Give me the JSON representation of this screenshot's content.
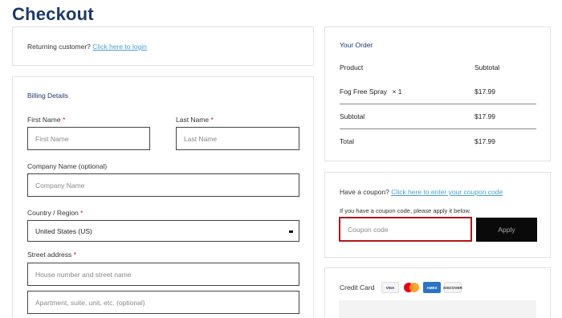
{
  "page": {
    "title": "Checkout"
  },
  "login": {
    "prompt": "Returning customer?",
    "link": "Click here to login"
  },
  "billing": {
    "heading": "Billing Details",
    "first_name": {
      "label": "First Name",
      "required": "*",
      "placeholder": "First Name"
    },
    "last_name": {
      "label": "Last Name",
      "required": "*",
      "placeholder": "Last Name"
    },
    "company": {
      "label": "Company Name (optional)",
      "placeholder": "Company Name"
    },
    "country": {
      "label": "Country / Region",
      "required": "*",
      "value": "United States (US)"
    },
    "street": {
      "label": "Street address",
      "required": "*",
      "placeholder": "House number and street name",
      "placeholder2": "Apartment, suite, unit, etc. (optional)"
    }
  },
  "order": {
    "heading": "Your Order",
    "col_product": "Product",
    "col_subtotal": "Subtotal",
    "items": [
      {
        "name": "Fog Free Spray",
        "qty": "× 1",
        "price": "$17.99"
      }
    ],
    "subtotal_label": "Subtotal",
    "subtotal_value": "$17.99",
    "total_label": "Total",
    "total_value": "$17.99"
  },
  "coupon": {
    "prompt": "Have a coupon?",
    "link": "Click here to enter your coupon code",
    "hint": "If you have a coupon code, please apply it below.",
    "placeholder": "Coupon code",
    "apply_label": "Apply",
    "highlight_color": "#b3161b"
  },
  "payment": {
    "method": "Credit Card",
    "cards": [
      "VISA",
      "mastercard",
      "AMEX",
      "DISCOVER"
    ]
  },
  "colors": {
    "heading": "#1d3a6a",
    "link": "#4a9fd0",
    "button": "#0a0a0a",
    "required": "#c8102e"
  }
}
